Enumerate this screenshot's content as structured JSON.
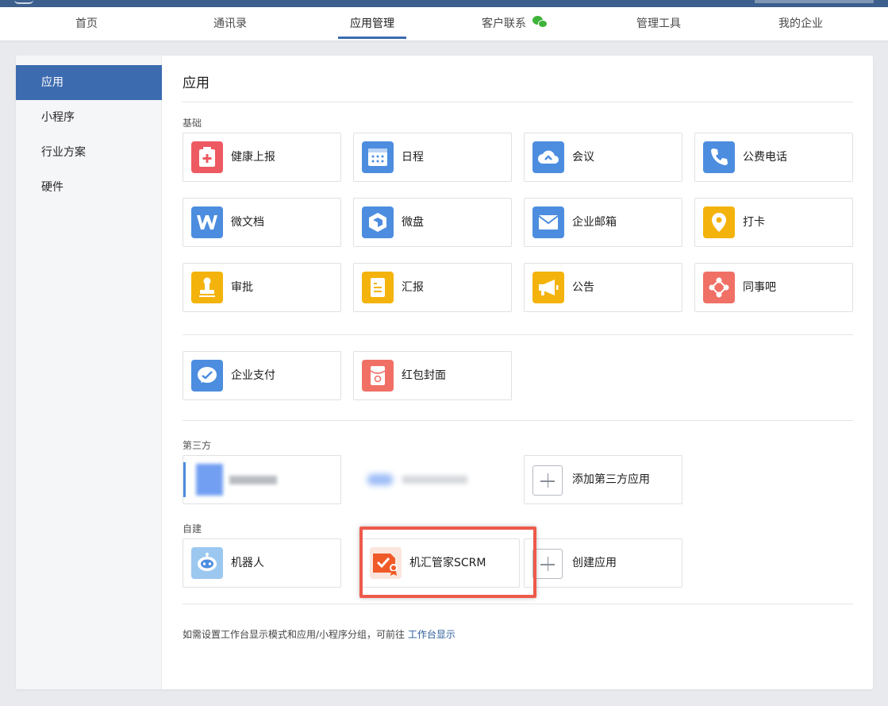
{
  "nav": {
    "items": [
      {
        "label": "首页",
        "active": false
      },
      {
        "label": "通讯录",
        "active": false
      },
      {
        "label": "应用管理",
        "active": true
      },
      {
        "label": "客户联系",
        "active": false,
        "icon": "wechat-icon"
      },
      {
        "label": "管理工具",
        "active": false
      },
      {
        "label": "我的企业",
        "active": false
      }
    ]
  },
  "sidebar": {
    "items": [
      {
        "label": "应用",
        "active": true
      },
      {
        "label": "小程序",
        "active": false
      },
      {
        "label": "行业方案",
        "active": false
      },
      {
        "label": "硬件",
        "active": false
      }
    ]
  },
  "main": {
    "title": "应用",
    "basic": {
      "label": "基础",
      "apps": [
        {
          "label": "健康上报",
          "icon": "health-report-icon",
          "color": "#ee5a62"
        },
        {
          "label": "日程",
          "icon": "calendar-icon",
          "color": "#4d8ddf"
        },
        {
          "label": "会议",
          "icon": "cloud-meeting-icon",
          "color": "#4d8ddf"
        },
        {
          "label": "公费电话",
          "icon": "phone-icon",
          "color": "#4d8ddf"
        },
        {
          "label": "微文档",
          "icon": "doc-w-icon",
          "color": "#4d8ddf"
        },
        {
          "label": "微盘",
          "icon": "drive-icon",
          "color": "#4d8ddf"
        },
        {
          "label": "企业邮箱",
          "icon": "mail-icon",
          "color": "#4d8ddf"
        },
        {
          "label": "打卡",
          "icon": "location-pin-icon",
          "color": "#f4b30c"
        },
        {
          "label": "审批",
          "icon": "stamp-icon",
          "color": "#f4b30c"
        },
        {
          "label": "汇报",
          "icon": "report-icon",
          "color": "#f4b30c"
        },
        {
          "label": "公告",
          "icon": "megaphone-icon",
          "color": "#f4b30c"
        },
        {
          "label": "同事吧",
          "icon": "network-icon",
          "color": "#f07066"
        }
      ]
    },
    "extra": {
      "apps": [
        {
          "label": "企业支付",
          "icon": "pay-icon",
          "color": "#4d8ddf"
        },
        {
          "label": "红包封面",
          "icon": "red-packet-icon",
          "color": "#f07066"
        }
      ]
    },
    "third_party": {
      "label": "第三方",
      "add_label": "添加第三方应用"
    },
    "custom": {
      "label": "自建",
      "apps": [
        {
          "label": "机器人",
          "icon": "robot-icon"
        },
        {
          "label": "机汇管家SCRM",
          "icon": "scrm-badge-icon",
          "color": "#f05a28"
        }
      ],
      "create_label": "创建应用"
    },
    "footnote": {
      "text": "如需设置工作台显示模式和应用/小程序分组，可前往 ",
      "link": "工作台显示"
    }
  }
}
